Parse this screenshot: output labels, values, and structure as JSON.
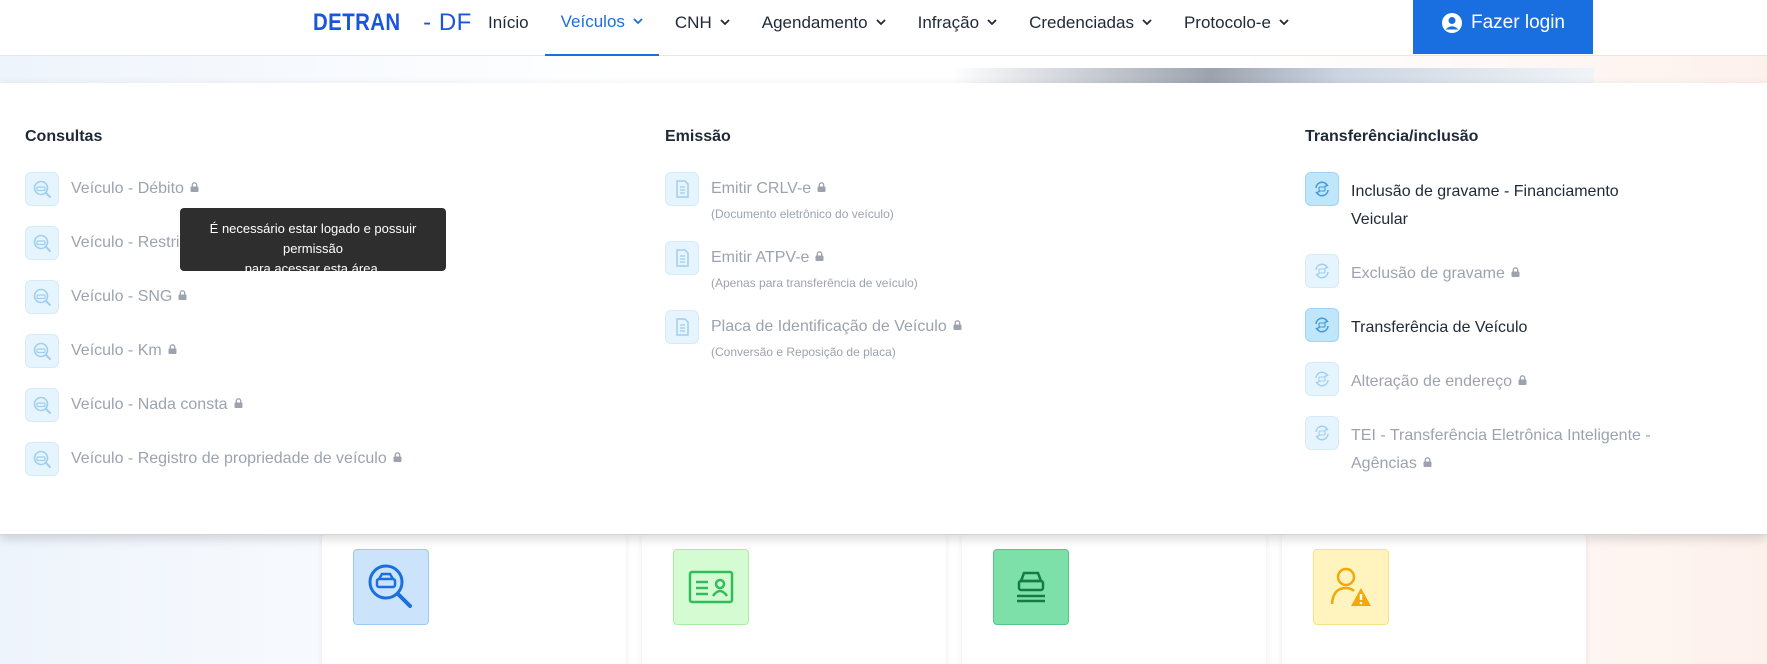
{
  "header": {
    "logo_main": "DETRAN",
    "logo_sep": " - ",
    "logo_region": "DF",
    "nav": [
      {
        "label": "Início",
        "dropdown": false,
        "active": false
      },
      {
        "label": "Veículos",
        "dropdown": true,
        "active": true
      },
      {
        "label": "CNH",
        "dropdown": true,
        "active": false
      },
      {
        "label": "Agendamento",
        "dropdown": true,
        "active": false
      },
      {
        "label": "Infração",
        "dropdown": true,
        "active": false
      },
      {
        "label": "Credenciadas",
        "dropdown": true,
        "active": false
      },
      {
        "label": "Protocolo-e",
        "dropdown": true,
        "active": false
      }
    ],
    "login_label": "Fazer login"
  },
  "menu": {
    "consultas": {
      "title": "Consultas",
      "items": [
        {
          "label": "Veículo - Débito",
          "locked": true
        },
        {
          "label": "Veículo - Restrições",
          "locked": true
        },
        {
          "label": "Veículo - SNG",
          "locked": true
        },
        {
          "label": "Veículo - Km",
          "locked": true
        },
        {
          "label": "Veículo - Nada consta",
          "locked": true
        },
        {
          "label": "Veículo - Registro de propriedade de veículo",
          "locked": true
        }
      ]
    },
    "emissao": {
      "title": "Emissão",
      "items": [
        {
          "label": "Emitir CRLV-e",
          "sub": "(Documento eletrônico do veículo)",
          "locked": true
        },
        {
          "label": "Emitir ATPV-e",
          "sub": "(Apenas para transferência de veículo)",
          "locked": true
        },
        {
          "label": "Placa de Identificação de Veículo",
          "sub": "(Conversão e Reposição de placa)",
          "locked": true
        }
      ]
    },
    "transferencia": {
      "title": "Transferência/inclusão",
      "items": [
        {
          "label": "Inclusão de gravame - Financiamento Veicular",
          "locked": false
        },
        {
          "label": "Exclusão de gravame",
          "locked": true
        },
        {
          "label": "Transferência de Veículo",
          "locked": false
        },
        {
          "label": "Alteração de endereço",
          "locked": true
        },
        {
          "label": "TEI - Transferência Eletrônica Inteligente - Agências",
          "locked": true
        }
      ]
    }
  },
  "tooltip": {
    "line1": "É necessário estar logado e possuir permissão",
    "line2": "para acessar esta área."
  },
  "colors": {
    "primary": "#1a6fe0",
    "card_icon_1": "#cce4fb",
    "card_icon_2": "#d5fbd2",
    "card_icon_3": "#7ce0a8",
    "card_icon_4": "#fff4bd"
  },
  "icons": {
    "search-car": "search-car-icon",
    "document": "document-icon",
    "transfer": "transfer-icon",
    "lock": "lock-icon",
    "user": "user-circle-icon",
    "chevron": "chevron-down-icon"
  }
}
